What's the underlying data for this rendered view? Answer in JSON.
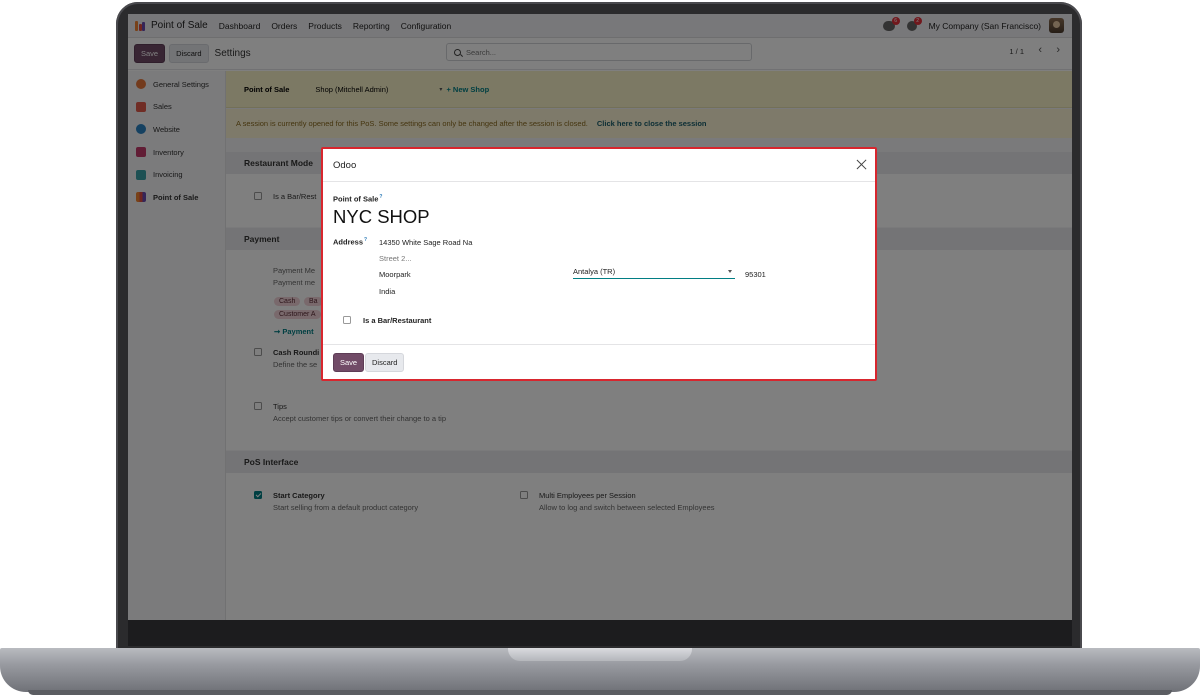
{
  "navbar": {
    "app_name": "Point of Sale",
    "menu": [
      "Dashboard",
      "Orders",
      "Products",
      "Reporting",
      "Configuration"
    ],
    "chat_count": "6",
    "activity_count": "2",
    "company": "My Company (San Francisco)"
  },
  "control": {
    "save_label": "Save",
    "discard_label": "Discard",
    "title": "Settings",
    "search_placeholder": "Search...",
    "pager": "1 / 1"
  },
  "sidebar": {
    "items": [
      {
        "label": "General Settings",
        "color": "#e7773a"
      },
      {
        "label": "Sales",
        "color": "#e05b4b"
      },
      {
        "label": "Website",
        "color": "#2a82c3"
      },
      {
        "label": "Inventory",
        "color": "#c23a6a"
      },
      {
        "label": "Invoicing",
        "color": "#3aa0a6"
      },
      {
        "label": "Point of Sale",
        "color": "#f08330"
      }
    ]
  },
  "settings": {
    "pos_label": "Point of Sale",
    "pos_value": "Shop (Mitchell Admin)",
    "new_shop": "+ New Shop",
    "alert_text": "A session is currently opened for this PoS. Some settings can only be changed after the session is closed.",
    "alert_link": "Click here to close the session",
    "restaurant_section": "Restaurant Mode",
    "restaurant_option": "Is a Bar/Rest",
    "payment_section": "Payment",
    "payment_methods_title": "Payment Me",
    "payment_methods_desc": "Payment me",
    "payment_tags": [
      "Cash",
      "Ba",
      "Customer A"
    ],
    "payment_link": "Payment",
    "cash_rounding_title": "Cash Roundi",
    "cash_rounding_desc": "Define the se",
    "tips_title": "Tips",
    "tips_desc": "Accept customer tips or convert their change to a tip",
    "interface_section": "PoS Interface",
    "start_category_title": "Start Category",
    "start_category_desc": "Start selling from a default product category",
    "multi_emp_title": "Multi Employees per Session",
    "multi_emp_desc": "Allow to log and switch between selected Employees"
  },
  "dialog": {
    "title": "Odoo",
    "pos_label": "Point of Sale",
    "help_mark": "?",
    "name": "NYC SHOP",
    "address_label": "Address",
    "street": "14350 White Sage Road Na",
    "street2_placeholder": "Street 2...",
    "city": "Moorpark",
    "state": "Antalya (TR)",
    "zip": "95301",
    "country": "India",
    "bar_label": "Is a Bar/Restaurant",
    "save_label": "Save",
    "discard_label": "Discard"
  }
}
